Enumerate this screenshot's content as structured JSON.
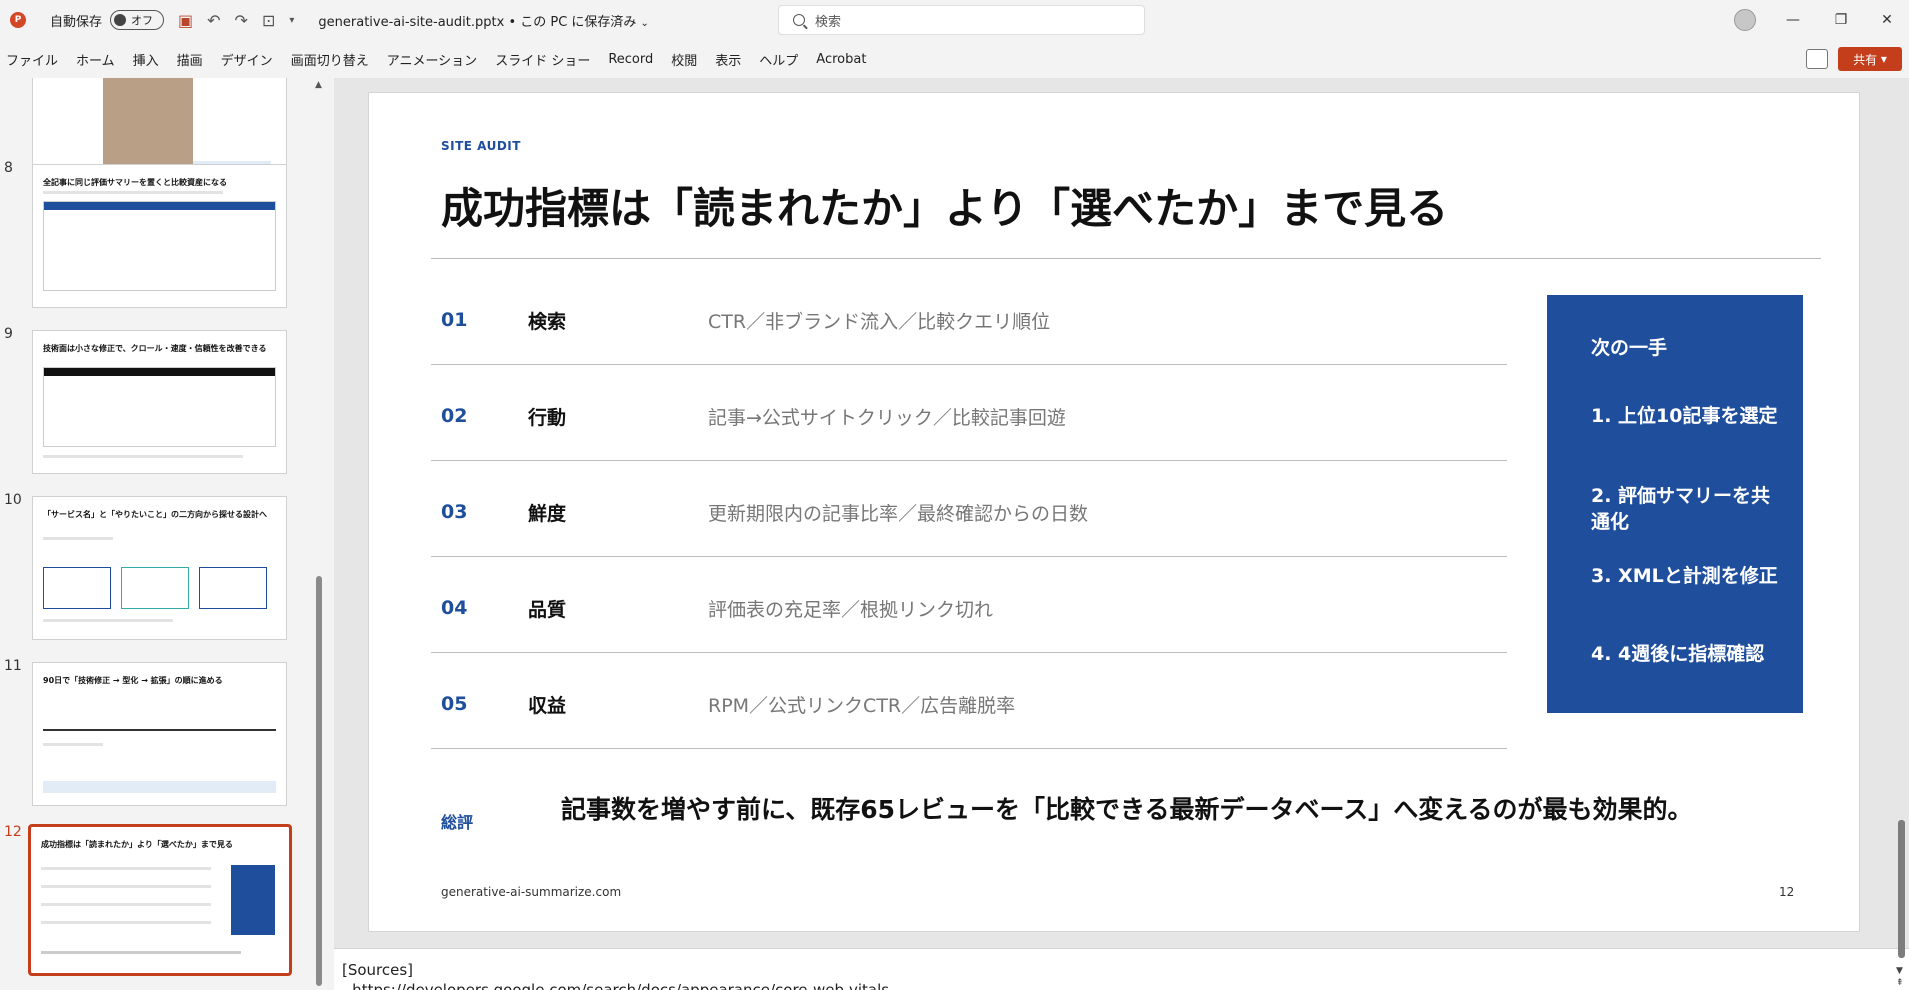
{
  "titlebar": {
    "autosave_label": "自動保存",
    "autosave_state": "オフ",
    "document_title": "generative-ai-site-audit.pptx • この PC に保存済み",
    "search_placeholder": "検索"
  },
  "menu": [
    "ファイル",
    "ホーム",
    "挿入",
    "描画",
    "デザイン",
    "画面切り替え",
    "アニメーション",
    "スライド ショー",
    "Record",
    "校閲",
    "表示",
    "ヘルプ",
    "Acrobat"
  ],
  "share_label": "共有",
  "thumbnails": [
    {
      "number": "8",
      "title": "全記事に同じ評価サマリーを置くと比較資産になる"
    },
    {
      "number": "9",
      "title": "技術面は小さな修正で、クロール・速度・信頼性を改善できる"
    },
    {
      "number": "10",
      "title": "「サービス名」と「やりたいこと」の二方向から探せる設計へ"
    },
    {
      "number": "11",
      "title": "90日で「技術修正 → 型化 → 拡張」の順に進める"
    },
    {
      "number": "12",
      "title": "成功指標は「読まれたか」より「選べたか」まで見る"
    }
  ],
  "slide": {
    "eyebrow": "SITE AUDIT",
    "title": "成功指標は「読まれたか」より「選べたか」まで見る",
    "rows": [
      {
        "num": "01",
        "label": "検索",
        "desc": "CTR／非ブランド流入／比較クエリ順位"
      },
      {
        "num": "02",
        "label": "行動",
        "desc": "記事→公式サイトクリック／比較記事回遊"
      },
      {
        "num": "03",
        "label": "鮮度",
        "desc": "更新期限内の記事比率／最終確認からの日数"
      },
      {
        "num": "04",
        "label": "品質",
        "desc": "評価表の充足率／根拠リンク切れ"
      },
      {
        "num": "05",
        "label": "収益",
        "desc": "RPM／公式リンクCTR／広告離脱率"
      }
    ],
    "next_panel": {
      "title": "次の一手",
      "items": [
        "1. 上位10記事を選定",
        "2. 評価サマリーを共通化",
        "3. XMLと計測を修正",
        "4. 4週後に指標確認"
      ]
    },
    "summary_label": "総評",
    "summary_text": "記事数を増やす前に、既存65レビューを「比較できる最新データベース」へ変えるのが最も効果的。",
    "footer_source": "generative-ai-summarize.com",
    "footer_page": "12"
  },
  "notes": {
    "line1": "[Sources]",
    "line2": "- https://developers.google.com/search/docs/appearance/core-web-vitals"
  },
  "colors": {
    "accent": "#1f4e9c",
    "office_red": "#c43e1c"
  }
}
